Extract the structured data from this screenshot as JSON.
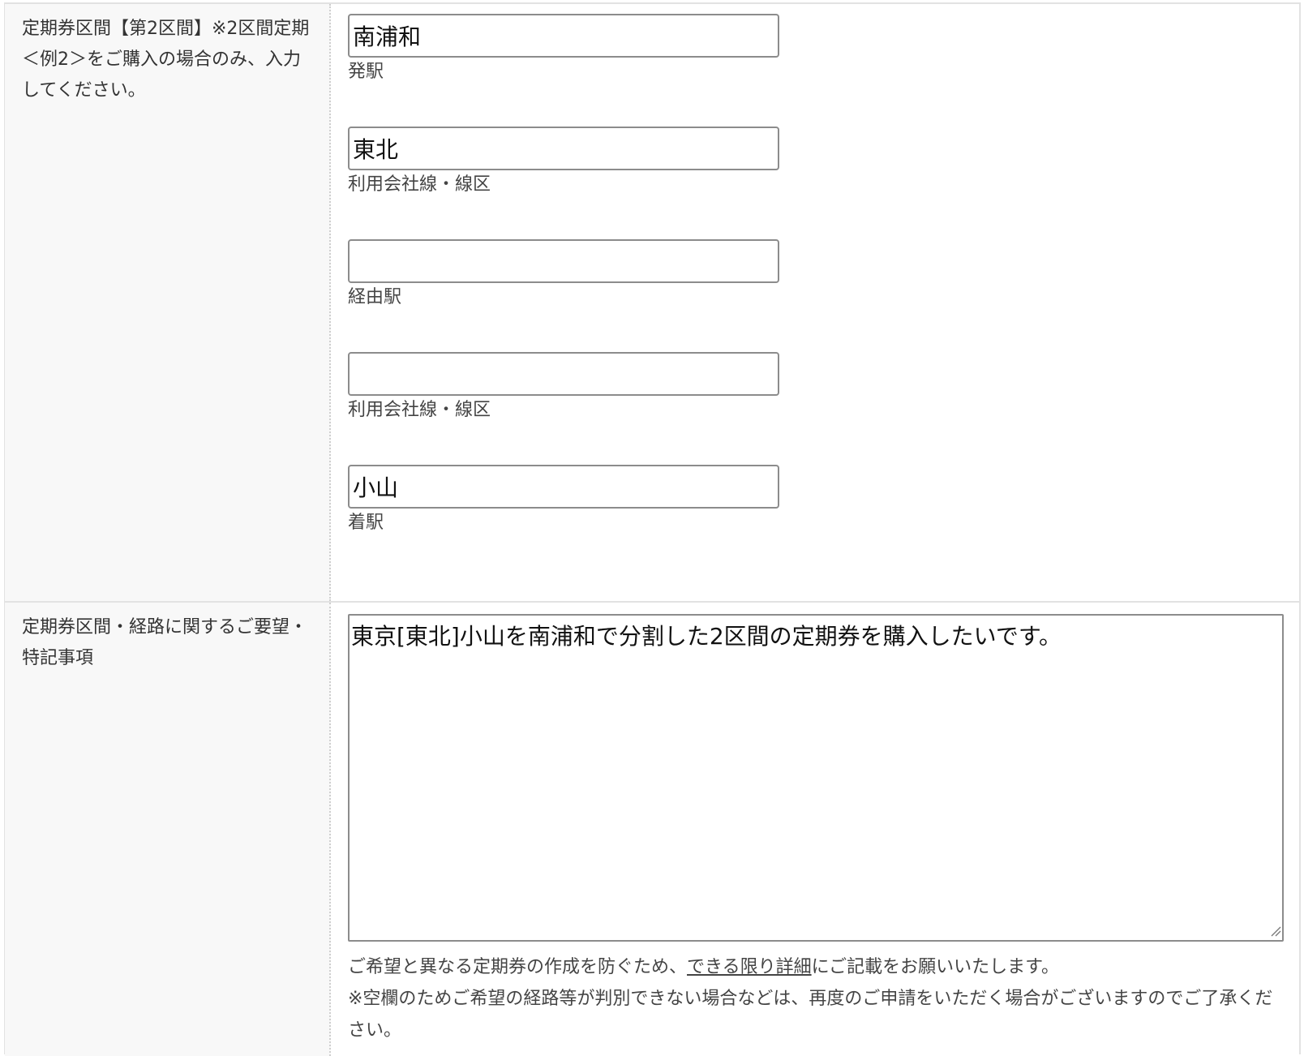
{
  "section1": {
    "label": "定期券区間【第2区間】※2区間定期＜例2＞をご購入の場合のみ、入力してください。",
    "fields": [
      {
        "value": "南浦和",
        "caption": "発駅"
      },
      {
        "value": "東北",
        "caption": "利用会社線・線区"
      },
      {
        "value": "",
        "caption": "経由駅"
      },
      {
        "value": "",
        "caption": "利用会社線・線区"
      },
      {
        "value": "小山",
        "caption": "着駅"
      }
    ]
  },
  "section2": {
    "label": "定期券区間・経路に関するご要望・特記事項",
    "textarea_value": "東京[東北]小山を南浦和で分割した2区間の定期券を購入したいです。",
    "note_prefix": "ご希望と異なる定期券の作成を防ぐため、",
    "note_link": "できる限り詳細",
    "note_suffix": "にご記載をお願いいたします。",
    "note_line2": "※空欄のためご希望の経路等が判別できない場合などは、再度のご申請をいただく場合がございますのでご了承ください。"
  }
}
